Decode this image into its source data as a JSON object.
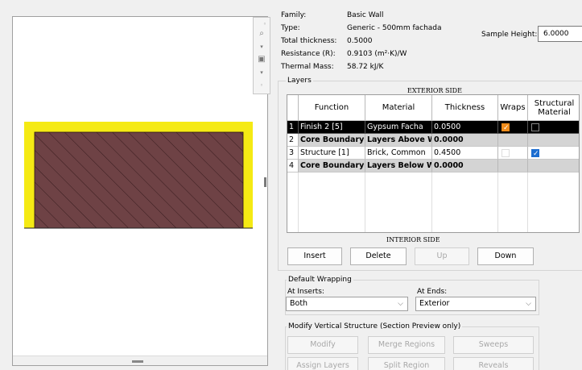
{
  "properties": {
    "family_label": "Family:",
    "family_value": "Basic Wall",
    "type_label": "Type:",
    "type_value": "Generic - 500mm fachada",
    "thickness_label": "Total thickness:",
    "thickness_value": "0.5000",
    "resistance_label": "Resistance (R):",
    "resistance_value": "0.9103 (m²·K)/W",
    "mass_label": "Thermal Mass:",
    "mass_value": "58.72 kJ/K",
    "sample_height_label": "Sample Height:",
    "sample_height_value": "6.0000"
  },
  "layers": {
    "group_label": "Layers",
    "exterior_label": "EXTERIOR SIDE",
    "interior_label": "INTERIOR SIDE",
    "columns": [
      "Function",
      "Material",
      "Thickness",
      "Wraps",
      "Structural Material"
    ],
    "rows": [
      {
        "num": "1",
        "function": "Finish 2 [5]",
        "material": "Gypsum Facha",
        "thickness": "0.0500",
        "wraps": true,
        "structural": false
      },
      {
        "num": "2",
        "function": "Core Boundary",
        "material": "Layers Above Wr",
        "thickness": "0.0000",
        "wraps": null,
        "structural": null
      },
      {
        "num": "3",
        "function": "Structure [1]",
        "material": "Brick, Common",
        "thickness": "0.4500",
        "wraps": false,
        "structural": true
      },
      {
        "num": "4",
        "function": "Core Boundary",
        "material": "Layers Below Wr",
        "thickness": "0.0000",
        "wraps": null,
        "structural": null
      }
    ],
    "buttons": {
      "insert": "Insert",
      "delete": "Delete",
      "up": "Up",
      "down": "Down"
    }
  },
  "wrapping": {
    "group_label": "Default Wrapping",
    "at_inserts_label": "At Inserts:",
    "at_inserts_value": "Both",
    "at_ends_label": "At Ends:",
    "at_ends_value": "Exterior"
  },
  "modify": {
    "group_label": "Modify Vertical Structure (Section Preview only)",
    "buttons": {
      "modify": "Modify",
      "merge": "Merge Regions",
      "sweeps": "Sweeps",
      "assign": "Assign Layers",
      "split": "Split Region",
      "reveals": "Reveals"
    }
  },
  "colors": {
    "selection": "#000000",
    "core_row": "#d4d4d4",
    "finish_fill": "#f5ea14",
    "structure_fill": "#6e4245",
    "checkbox_blue": "#1c6dd0",
    "checkbox_orange": "#f08c1a"
  },
  "icons": [
    "zoom-region-icon",
    "zoom-in-icon",
    "zoom-out-icon",
    "zoom-fit-icon"
  ]
}
